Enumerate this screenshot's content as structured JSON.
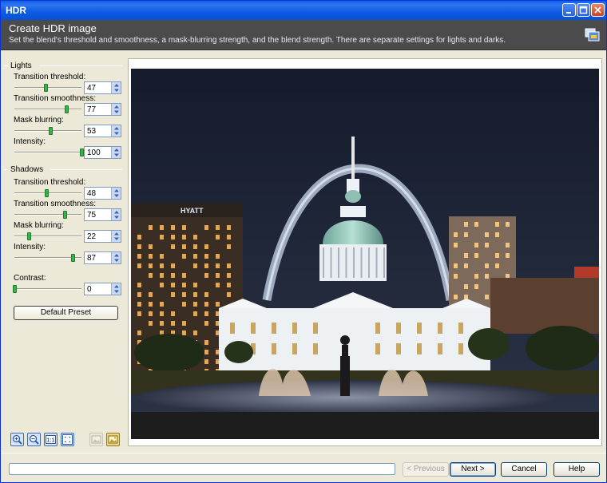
{
  "window": {
    "title": "HDR"
  },
  "header": {
    "title": "Create HDR image",
    "subtitle": "Set the blend's threshold and smoothness, a mask-blurring strength, and the blend strength. There are separate settings for lights and darks."
  },
  "lights": {
    "label": "Lights",
    "params": [
      {
        "label": "Transition threshold:",
        "value": "47",
        "level": 0.47
      },
      {
        "label": "Transition smoothness:",
        "value": "77",
        "level": 0.77
      },
      {
        "label": "Mask blurring:",
        "value": "53",
        "level": 0.53
      },
      {
        "label": "Intensity:",
        "value": "100",
        "level": 1.0
      }
    ]
  },
  "shadows": {
    "label": "Shadows",
    "params": [
      {
        "label": "Transition threshold:",
        "value": "48",
        "level": 0.48
      },
      {
        "label": "Transition smoothness:",
        "value": "75",
        "level": 0.75
      },
      {
        "label": "Mask blurring:",
        "value": "22",
        "level": 0.22
      },
      {
        "label": "Intensity:",
        "value": "87",
        "level": 0.87
      }
    ]
  },
  "contrast": {
    "label": "Contrast:",
    "value": "0",
    "level": 0.0
  },
  "preset_button": "Default Preset",
  "hotel_sign": "HYATT",
  "footer": {
    "previous": "< Previous",
    "next": "Next >",
    "cancel": "Cancel",
    "help": "Help"
  },
  "colors": {
    "title_bar": "#0a5fe8",
    "header_bg": "#4b4b4b",
    "slider_thumb": "#35b44a",
    "dialog_bg": "#ece9d8"
  }
}
